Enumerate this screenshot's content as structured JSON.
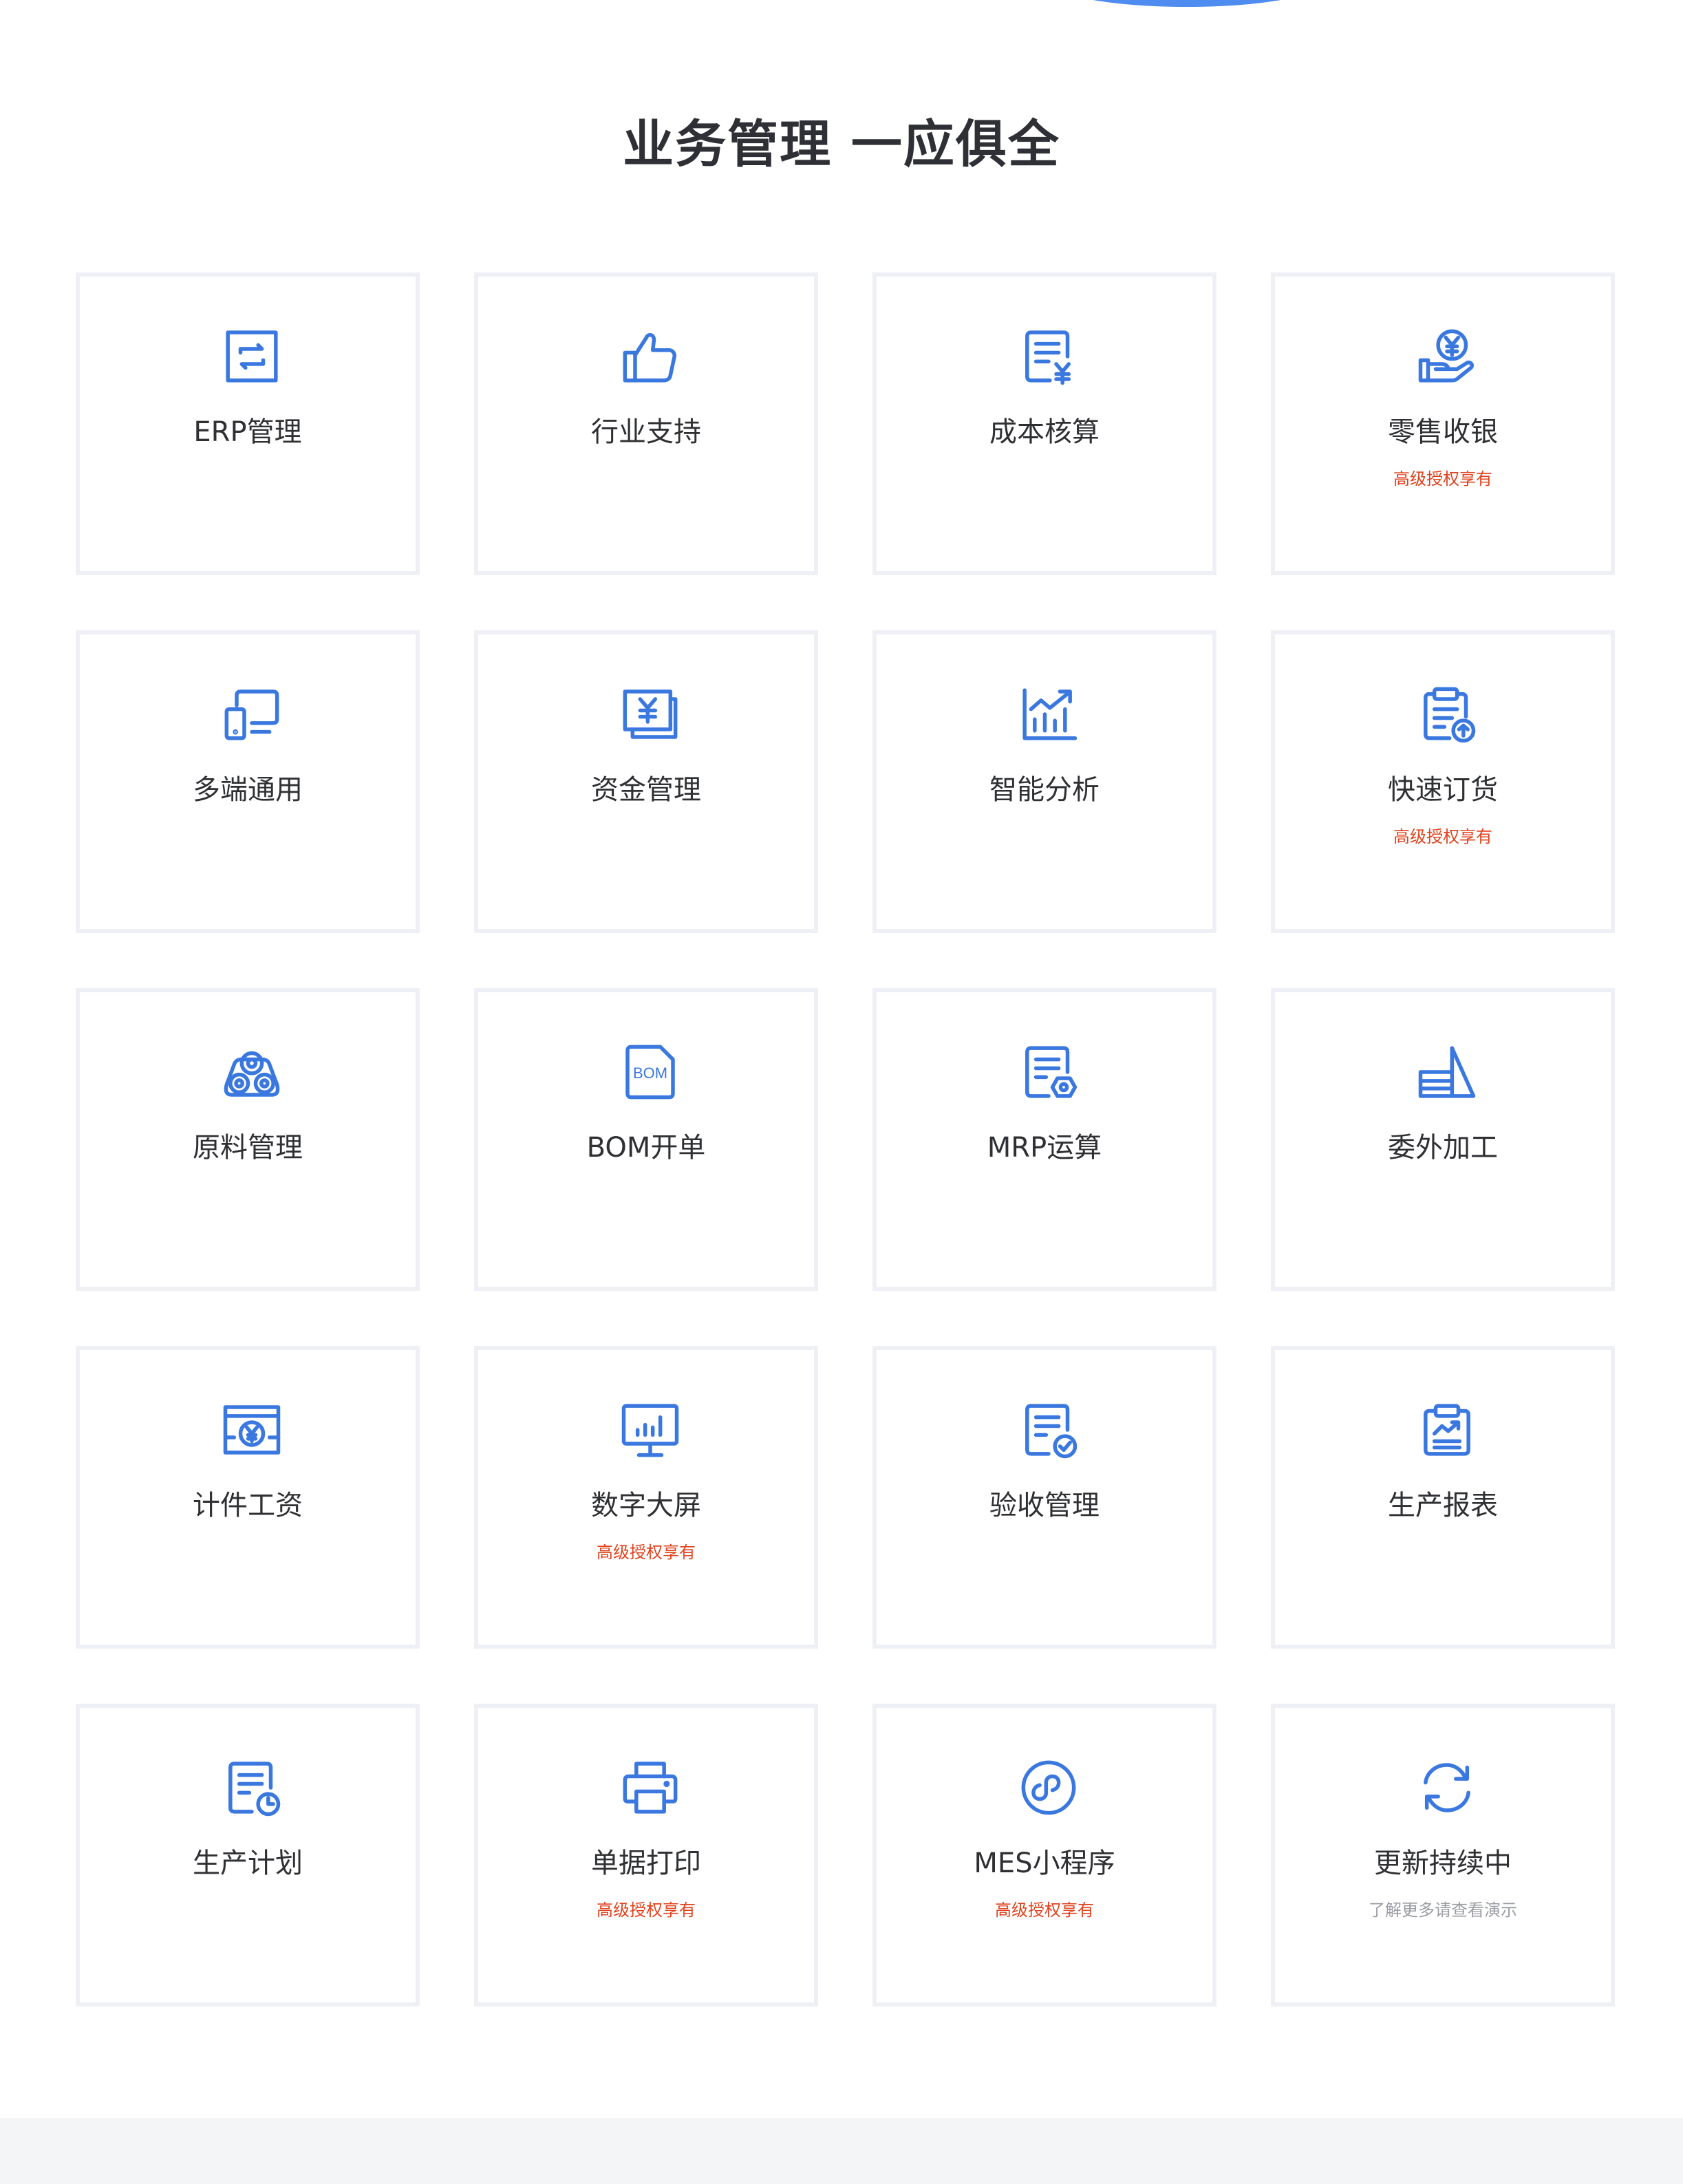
{
  "header": {
    "title": "业务管理 一应俱全"
  },
  "colors": {
    "accent": "#3a78e0",
    "highlight_note": "#e0431f",
    "muted_note": "#9a9ca3",
    "card_border": "#eef0f5",
    "title_text": "#2e3036"
  },
  "features": [
    {
      "label": "ERP管理",
      "icon": "sync-square-icon"
    },
    {
      "label": "行业支持",
      "icon": "thumbs-up-icon"
    },
    {
      "label": "成本核算",
      "icon": "yen-document-icon"
    },
    {
      "label": "零售收银",
      "icon": "yen-hand-icon",
      "note": "高级授权享有"
    },
    {
      "label": "多端通用",
      "icon": "multi-device-icon"
    },
    {
      "label": "资金管理",
      "icon": "yen-card-icon"
    },
    {
      "label": "智能分析",
      "icon": "growth-chart-icon"
    },
    {
      "label": "快速订货",
      "icon": "clipboard-upload-icon",
      "note": "高级授权享有"
    },
    {
      "label": "原料管理",
      "icon": "material-rolls-icon"
    },
    {
      "label": "BOM开单",
      "icon": "bom-file-icon",
      "icon_text": "BOM"
    },
    {
      "label": "MRP运算",
      "icon": "document-gear-icon"
    },
    {
      "label": "委外加工",
      "icon": "outsource-stack-icon"
    },
    {
      "label": "计件工资",
      "icon": "wage-window-icon"
    },
    {
      "label": "数字大屏",
      "icon": "monitor-chart-icon",
      "note": "高级授权享有"
    },
    {
      "label": "验收管理",
      "icon": "document-check-icon"
    },
    {
      "label": "生产报表",
      "icon": "clipboard-trend-icon"
    },
    {
      "label": "生产计划",
      "icon": "document-clock-icon"
    },
    {
      "label": "单据打印",
      "icon": "printer-icon",
      "note": "高级授权享有"
    },
    {
      "label": "MES小程序",
      "icon": "mini-program-icon",
      "note": "高级授权享有"
    },
    {
      "label": "更新持续中",
      "icon": "refresh-icon",
      "note": "了解更多请查看演示",
      "note_style": "gray"
    }
  ]
}
